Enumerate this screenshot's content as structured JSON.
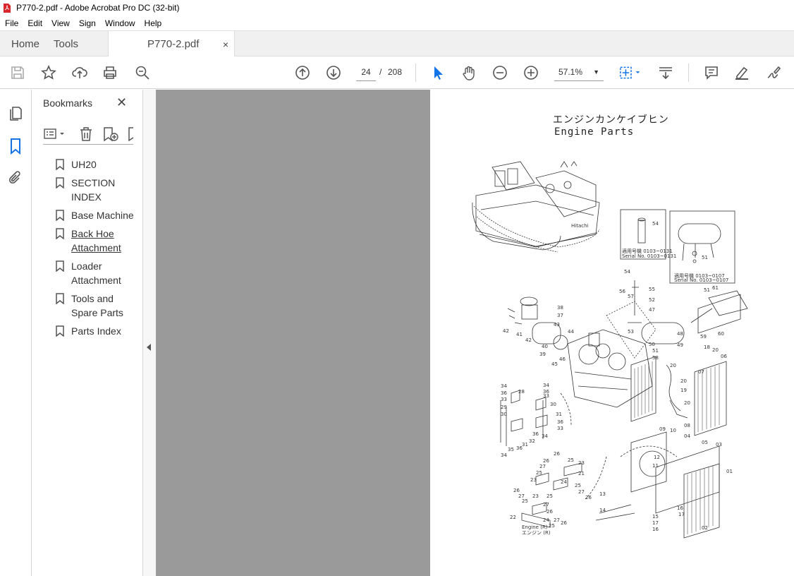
{
  "window": {
    "title": "P770-2.pdf - Adobe Acrobat Pro DC (32-bit)"
  },
  "menu": [
    "File",
    "Edit",
    "View",
    "Sign",
    "Window",
    "Help"
  ],
  "tabs": {
    "home": "Home",
    "tools": "Tools",
    "document": "P770-2.pdf",
    "close_glyph": "×"
  },
  "toolbar": {
    "current_page": "24",
    "page_separator": "/",
    "total_pages": "208",
    "zoom": "57.1%"
  },
  "bookmarks": {
    "title": "Bookmarks",
    "items": [
      {
        "label": "UH20",
        "link": false
      },
      {
        "label": "SECTION INDEX",
        "link": false
      },
      {
        "label": "Base Machine",
        "link": false
      },
      {
        "label": "Back Hoe Attachment",
        "link": true
      },
      {
        "label": "Loader Attachment",
        "link": false
      },
      {
        "label": "Tools and Spare Parts",
        "link": false
      },
      {
        "label": "Parts Index",
        "link": false
      }
    ]
  },
  "document_page": {
    "title_jp": "エンジンカンケイブヒン",
    "title_en": "Engine Parts",
    "inset_1": {
      "part_no": "54",
      "serial_jp": "適用号機 0103~0131",
      "serial_en": "Serial No. 0103~0131"
    },
    "inset_2": {
      "part_no": "51",
      "serial_jp": "適用号機 0103~0107",
      "serial_en": "Serial No. 0103~0107"
    },
    "engine_label_en": "Engine (R)",
    "engine_label_jp": "エンジン (R)",
    "callouts": [
      "54",
      "56",
      "55",
      "57",
      "52",
      "47",
      "53",
      "48",
      "49",
      "50",
      "51",
      "58",
      "38",
      "37",
      "43",
      "44",
      "42",
      "41",
      "40",
      "39",
      "46",
      "45",
      "61",
      "59",
      "60",
      "18",
      "20",
      "06",
      "07",
      "19",
      "34",
      "36",
      "28",
      "33",
      "30",
      "29",
      "31",
      "32",
      "35",
      "09",
      "10",
      "04",
      "05",
      "03",
      "08",
      "01",
      "12",
      "11",
      "26",
      "25",
      "23",
      "27",
      "21",
      "24",
      "22",
      "13",
      "14",
      "15",
      "16",
      "17",
      "02"
    ]
  },
  "icons": {
    "save": "save-icon",
    "star": "star-icon",
    "upload": "upload-icon",
    "print": "print-icon",
    "search": "zoom-search-icon",
    "prev": "prev-page-icon",
    "next": "next-page-icon",
    "select": "select-cursor-icon",
    "hand": "hand-icon",
    "zoom_out": "zoom-out-icon",
    "zoom_in": "zoom-in-icon",
    "fit": "fit-page-icon",
    "scroll": "scroll-mode-icon",
    "comment": "comment-icon",
    "highlight": "highlight-icon",
    "sign": "sign-icon"
  },
  "colors": {
    "accent": "#1473e6",
    "page_bg": "#9a9a9a",
    "pdf_red": "#d8262b"
  }
}
